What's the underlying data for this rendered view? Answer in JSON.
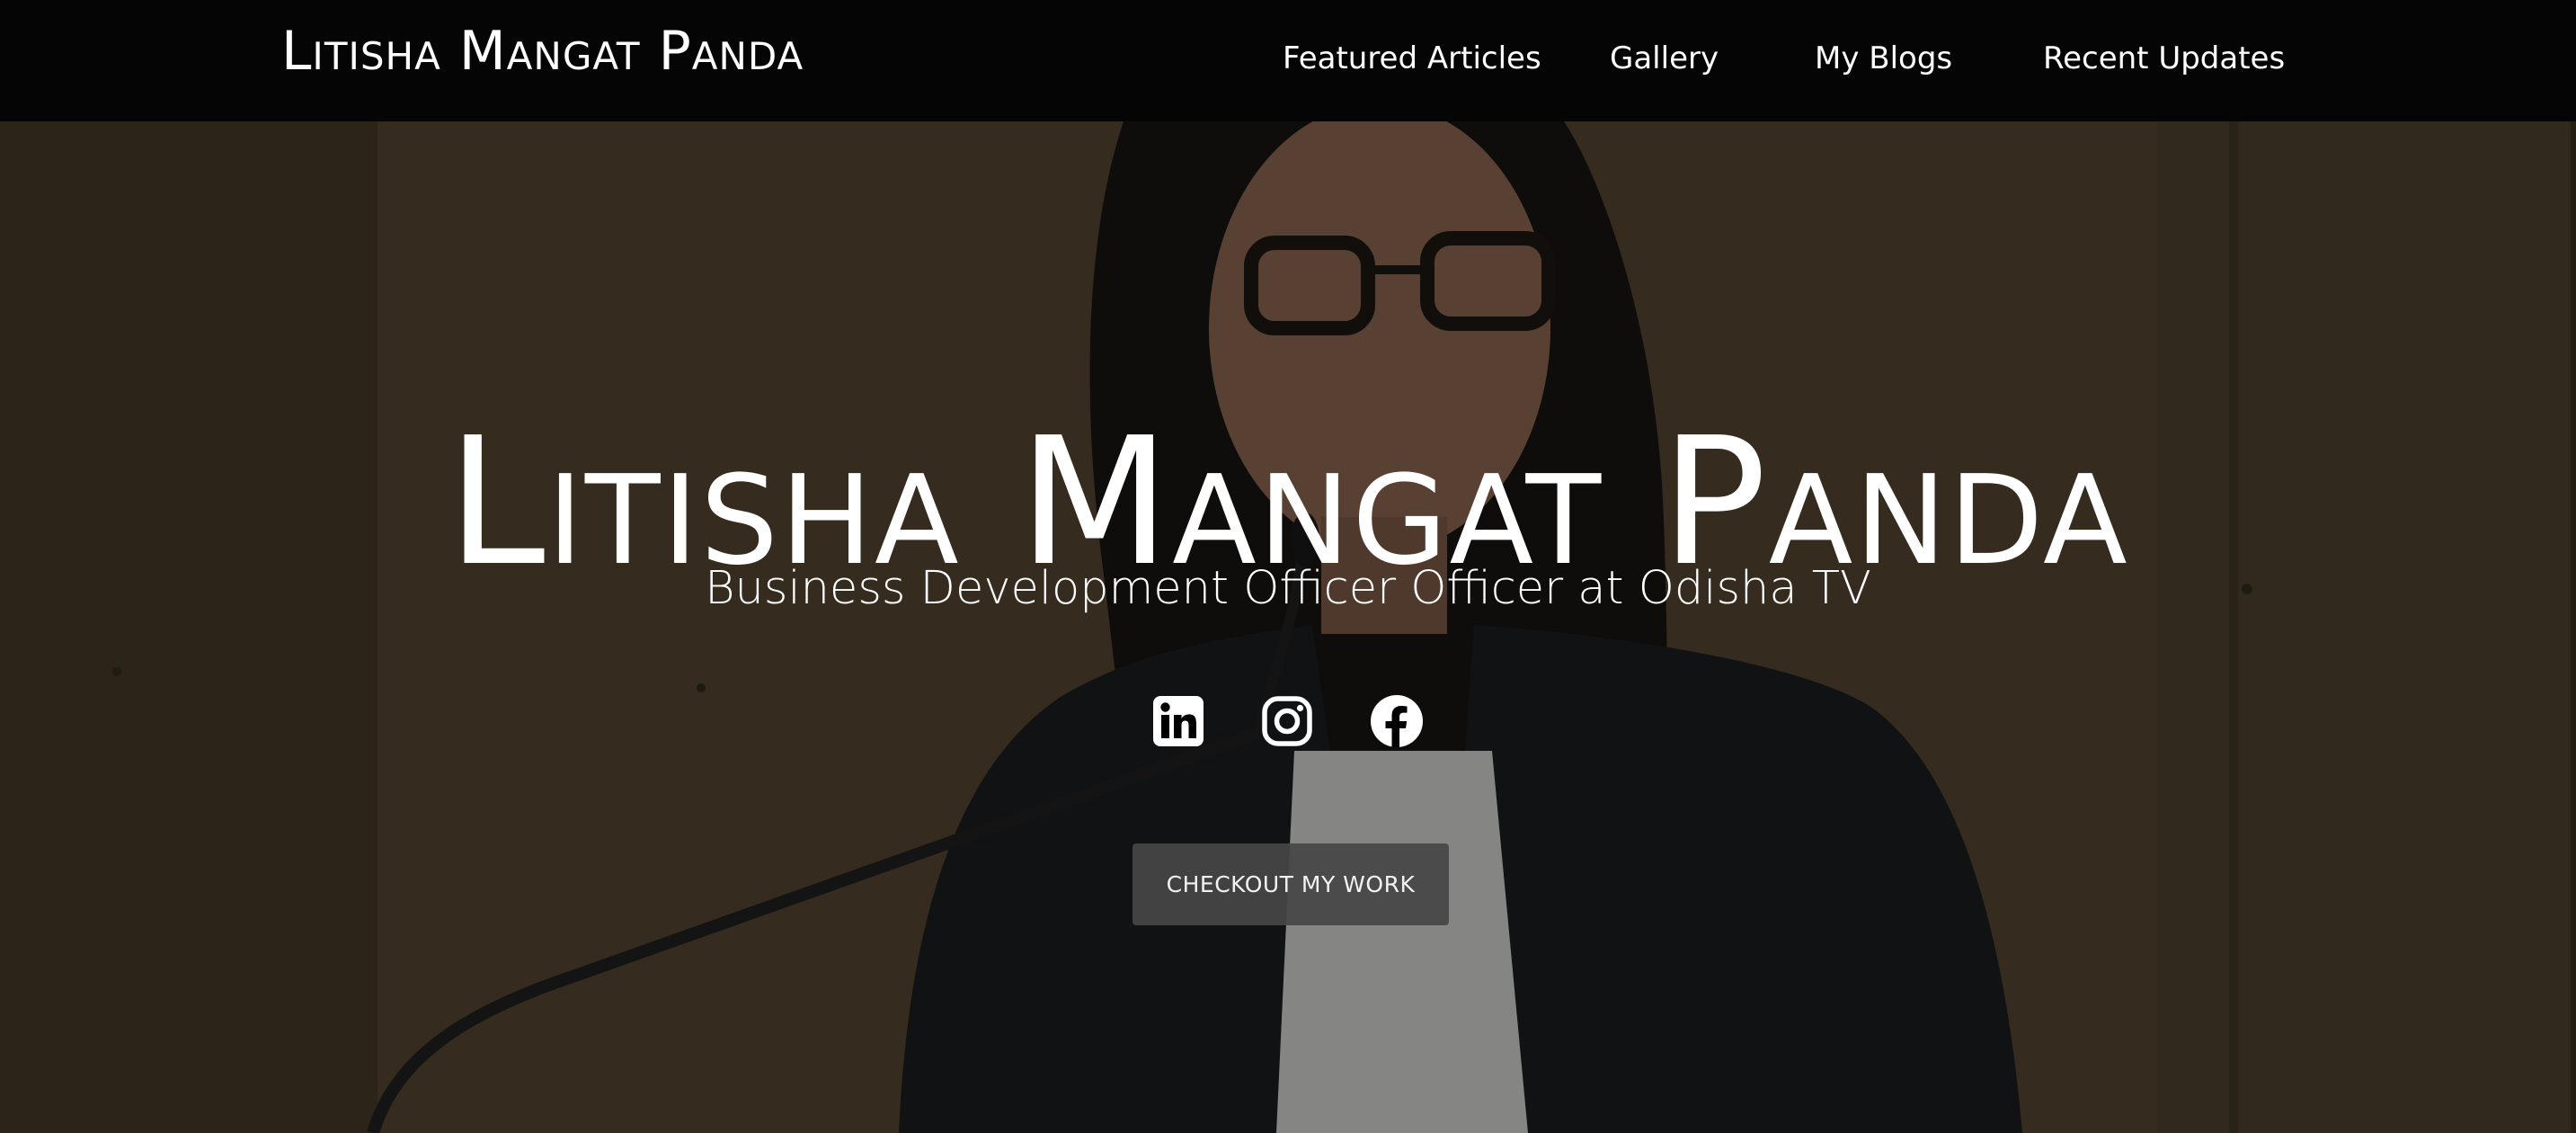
{
  "header": {
    "brand": "Litisha Mangat Panda",
    "nav": [
      {
        "label": "Featured Articles"
      },
      {
        "label": "Gallery"
      },
      {
        "label": "My Blogs"
      },
      {
        "label": "Recent Updates"
      }
    ]
  },
  "hero": {
    "title": "Litisha Mangat Panda",
    "subtitle": "Business Development Officer Officer at Odisha TV",
    "social": [
      {
        "icon": "linkedin-icon"
      },
      {
        "icon": "instagram-icon"
      },
      {
        "icon": "facebook-icon"
      }
    ],
    "cta_label": "CHECKOUT MY WORK"
  },
  "colors": {
    "topbar": "#050505",
    "text": "#ffffff",
    "cta_background": "#464646"
  }
}
